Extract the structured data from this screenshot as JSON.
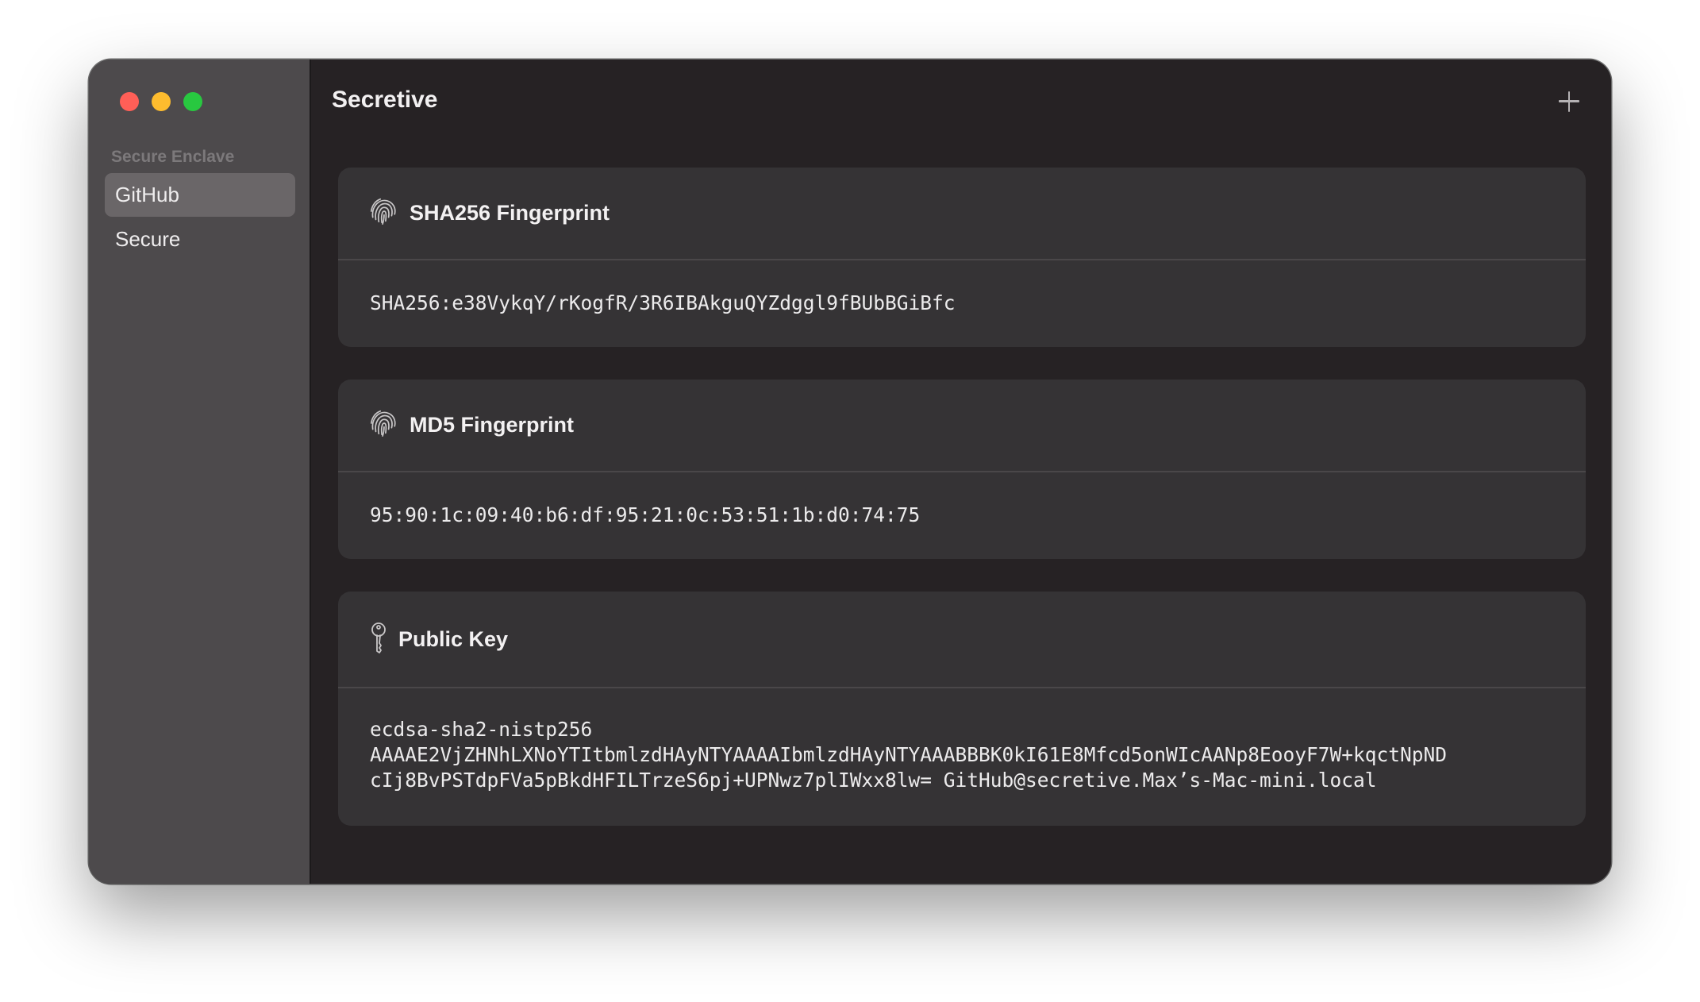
{
  "window": {
    "title": "Secretive"
  },
  "sidebar": {
    "section_heading": "Secure Enclave",
    "items": [
      {
        "label": "GitHub",
        "selected": true
      },
      {
        "label": "Secure",
        "selected": false
      }
    ]
  },
  "toolbar": {
    "add_icon": "plus-icon"
  },
  "cards": {
    "sha256": {
      "icon": "fingerprint-icon",
      "label": "SHA256 Fingerprint",
      "value": "SHA256:e38VykqY/rKogfR/3R6IBAkguQYZdggl9fBUbBGiBfc"
    },
    "md5": {
      "icon": "fingerprint-icon",
      "label": "MD5 Fingerprint",
      "value": "95:90:1c:09:40:b6:df:95:21:0c:53:51:1b:d0:74:75"
    },
    "public_key": {
      "icon": "key-icon",
      "label": "Public Key",
      "lines": [
        "ecdsa-sha2-nistp256",
        "AAAAE2VjZHNhLXNoYTItbmlzdHAyNTYAAAAIbmlzdHAyNTYAAABBBK0kI61E8Mfcd5onWIcAANp8EooyF7W+kqctNpND",
        "cIj8BvPSTdpFVa5pBkdHFILTrzeS6pj+UPNwz7plIWxx8lw= GitHub@secretive.Max’s-Mac-mini.local"
      ]
    }
  },
  "colors": {
    "close": "#ff5f57",
    "minimize": "#febc2e",
    "maximize": "#28c840",
    "sidebar_bg": "#4d4a4c",
    "main_bg": "#262224",
    "card_bg": "#353335"
  }
}
